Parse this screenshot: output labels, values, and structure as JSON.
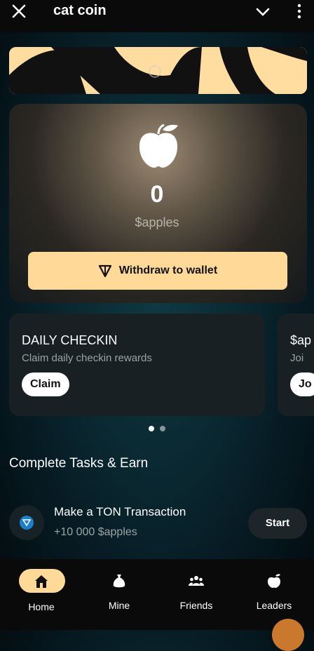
{
  "header": {
    "title": "cat coin"
  },
  "balance": {
    "amount": "0",
    "currency": "$apples"
  },
  "withdraw": {
    "label": "Withdraw to wallet"
  },
  "carousel": {
    "cards": [
      {
        "title": "DAILY CHECKIN",
        "subtitle": "Claim daily checkin rewards",
        "button": "Claim"
      },
      {
        "title": "$ap",
        "subtitle": "Joi",
        "button": "Jo"
      }
    ],
    "active_index": 0,
    "count": 2
  },
  "tasks": {
    "heading": "Complete Tasks & Earn",
    "items": [
      {
        "title": "Make a TON Transaction",
        "reward": "+10 000 $apples",
        "button": "Start"
      }
    ]
  },
  "nav": {
    "items": [
      {
        "label": "Home",
        "icon": "home-icon",
        "active": true
      },
      {
        "label": "Mine",
        "icon": "sack-icon",
        "active": false
      },
      {
        "label": "Friends",
        "icon": "friends-icon",
        "active": false
      },
      {
        "label": "Leaders",
        "icon": "apple-icon",
        "active": false
      }
    ]
  },
  "colors": {
    "accent": "#ffd997",
    "background": "#0b2a33",
    "card": "#182023"
  }
}
